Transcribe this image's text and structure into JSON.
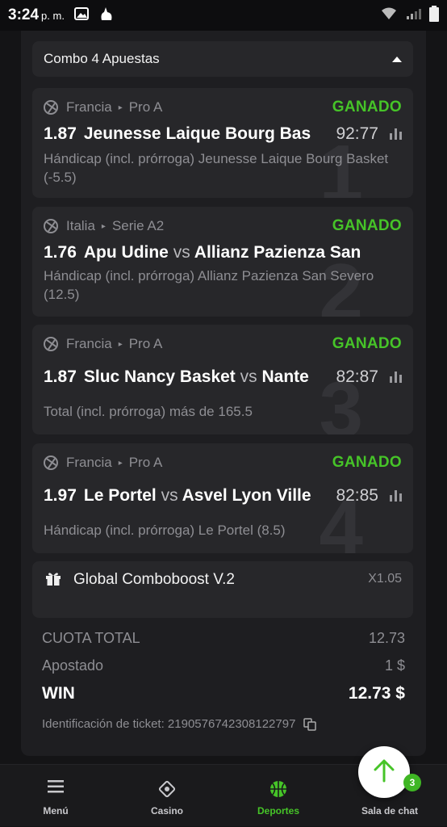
{
  "status_bar": {
    "time": "3:24",
    "ampm": "p. m."
  },
  "combo": {
    "title": "Combo 4 Apuestas"
  },
  "bets": [
    {
      "number": "1",
      "country": "Francia",
      "league": "Pro A",
      "status": "GANADO",
      "odds": "1.87",
      "home": "Jeunesse Laique Bourg Bas",
      "vs": "",
      "away": "",
      "score": "92:77",
      "market": "Hándicap (incl. prórroga) Jeunesse Laique Bourg Basket (-5.5)"
    },
    {
      "number": "2",
      "country": "Italia",
      "league": "Serie A2",
      "status": "GANADO",
      "odds": "1.76",
      "home": "Apu Udine",
      "vs": "vs",
      "away": "Allianz Pazienza San",
      "score": "",
      "market": "Hándicap (incl. prórroga) Allianz Pazienza San Severo (12.5)"
    },
    {
      "number": "3",
      "country": "Francia",
      "league": "Pro A",
      "status": "GANADO",
      "odds": "1.87",
      "home": "Sluc Nancy Basket",
      "vs": "vs",
      "away": "Nante",
      "score": "82:87",
      "market": "Total (incl. prórroga) más de 165.5"
    },
    {
      "number": "4",
      "country": "Francia",
      "league": "Pro A",
      "status": "GANADO",
      "odds": "1.97",
      "home": "Le Portel",
      "vs": "vs",
      "away": "Asvel Lyon Ville",
      "score": "82:85",
      "market": "Hándicap (incl. prórroga) Le Portel (8.5)"
    }
  ],
  "boost": {
    "name": "Global Comboboost V.2",
    "multiplier": "X1.05"
  },
  "totals": {
    "cuota_label": "CUOTA TOTAL",
    "cuota_value": "12.73",
    "apostado_label": "Apostado",
    "apostado_value": "1 $",
    "win_label": "WIN",
    "win_value": "12.73 $"
  },
  "ticket": {
    "label": "Identificación de ticket: 2190576742308122797"
  },
  "nav": [
    {
      "label": "Menú",
      "icon": "menu-icon"
    },
    {
      "label": "Casino",
      "icon": "casino-icon"
    },
    {
      "label": "Deportes",
      "icon": "basketball-icon",
      "active": true
    },
    {
      "label": "Sala de chat",
      "icon": "chat-icon",
      "badge": "3"
    }
  ],
  "colors": {
    "won": "#46c428",
    "panel": "#1e1e21",
    "card": "#27272a"
  }
}
